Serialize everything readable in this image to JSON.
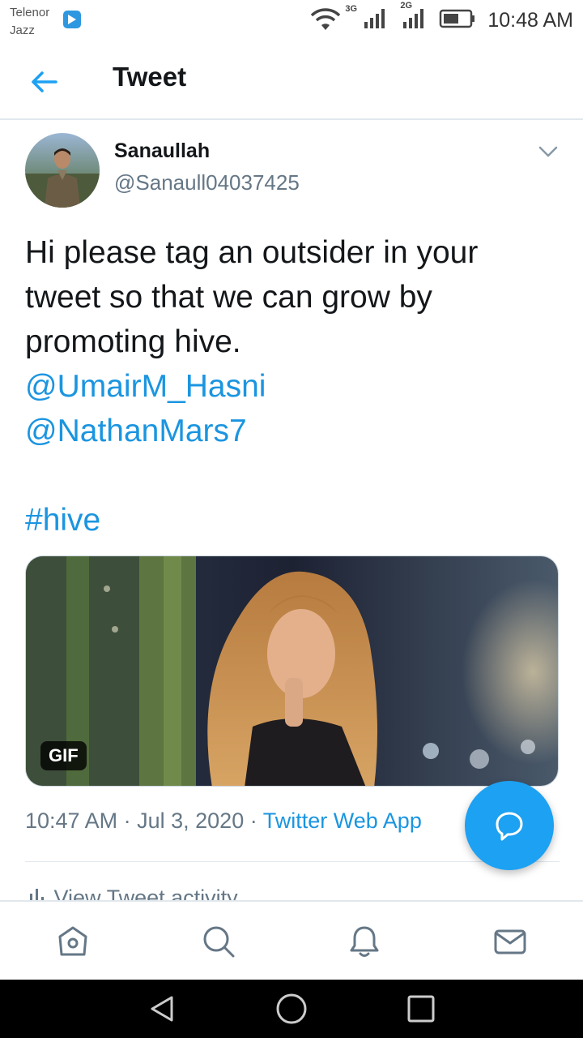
{
  "status_bar": {
    "carrier_line1": "Telenor",
    "carrier_line2": "Jazz",
    "network1": "3G",
    "network2": "2G",
    "time": "10:48 AM",
    "icons": [
      "play-store-icon",
      "wifi-icon",
      "signal-icon",
      "battery-icon"
    ]
  },
  "header": {
    "back_icon": "arrow-left-icon",
    "title": "Tweet"
  },
  "tweet": {
    "author_name": "Sanaullah",
    "author_handle": "@Sanaull04037425",
    "text_lines": [
      "Hi please tag an outsider in your",
      "tweet so that we can grow by",
      "promoting hive."
    ],
    "mentions": [
      "@UmairM_Hasni",
      "@NathanMars7"
    ],
    "hashtag": "#hive",
    "media_badge": "GIF",
    "time": "10:47 AM",
    "date": "Jul 3, 2020",
    "source": "Twitter Web App",
    "separator": "·",
    "activity_label": "View Tweet activity"
  },
  "fab": {
    "icon": "reply-bubble-icon"
  },
  "tabs": [
    {
      "name": "home",
      "icon": "home-icon"
    },
    {
      "name": "search",
      "icon": "search-icon"
    },
    {
      "name": "notifications",
      "icon": "bell-icon"
    },
    {
      "name": "messages",
      "icon": "mail-icon"
    }
  ],
  "colors": {
    "link": "#1b95e0",
    "fab": "#1da1f2",
    "text": "#14171a",
    "secondary": "#657786"
  }
}
